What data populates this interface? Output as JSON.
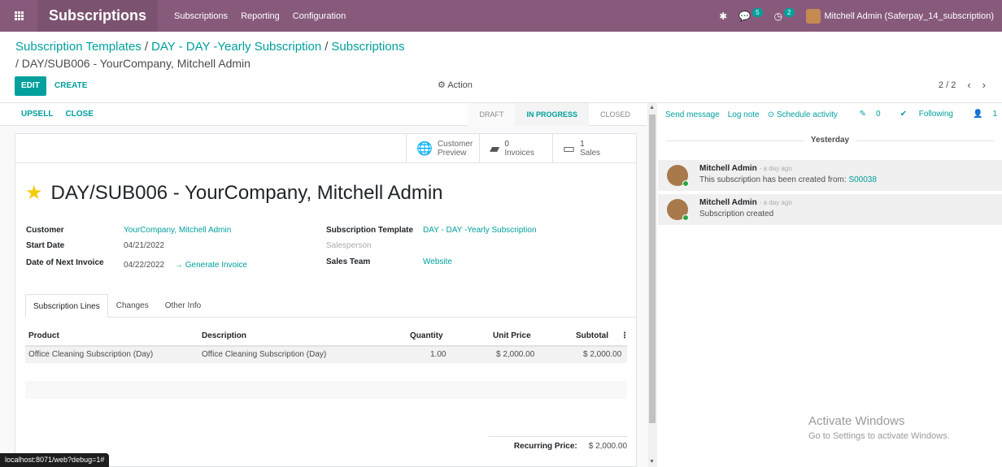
{
  "topbar": {
    "app_name": "Subscriptions",
    "menu": [
      "Subscriptions",
      "Reporting",
      "Configuration"
    ],
    "messages_count": "5",
    "activities_count": "2",
    "user_name": "Mitchell Admin (Saferpay_14_subscription)"
  },
  "breadcrumb": {
    "level1": "Subscription Templates",
    "level2": "DAY - DAY -Yearly Subscription",
    "level3": "Subscriptions",
    "current": "/ DAY/SUB006 - YourCompany, Mitchell Admin"
  },
  "control": {
    "edit_label": "EDIT",
    "create_label": "CREATE",
    "action_label": "Action",
    "pager": "2 / 2"
  },
  "statusbar": {
    "upsell_label": "UPSELL",
    "close_label": "CLOSE",
    "stages": [
      "DRAFT",
      "IN PROGRESS",
      "CLOSED"
    ],
    "active_stage": "IN PROGRESS"
  },
  "smart_buttons": {
    "customer_preview": "Customer Preview",
    "customer_preview_l1": "Customer",
    "customer_preview_l2": "Preview",
    "invoices_count": "0",
    "invoices_label": "Invoices",
    "sales_count": "1",
    "sales_label": "Sales"
  },
  "record": {
    "title": "DAY/SUB006 - YourCompany, Mitchell Admin",
    "customer_label": "Customer",
    "customer": "YourCompany, Mitchell Admin",
    "start_date_label": "Start Date",
    "start_date": "04/21/2022",
    "next_invoice_label": "Date of Next Invoice",
    "next_invoice": "04/22/2022",
    "generate_invoice": "Generate Invoice",
    "template_label": "Subscription Template",
    "template": "DAY - DAY -Yearly Subscription",
    "salesperson_label": "Salesperson",
    "sales_team_label": "Sales Team",
    "sales_team": "Website"
  },
  "tabs": [
    "Subscription Lines",
    "Changes",
    "Other Info"
  ],
  "lines": {
    "headers": {
      "product": "Product",
      "description": "Description",
      "quantity": "Quantity",
      "unit_price": "Unit Price",
      "subtotal": "Subtotal"
    },
    "rows": [
      {
        "product": "Office Cleaning Subscription (Day)",
        "description": "Office Cleaning Subscription (Day)",
        "quantity": "1.00",
        "unit_price": "$ 2,000.00",
        "subtotal": "$ 2,000.00"
      }
    ],
    "recurring_label": "Recurring Price:",
    "recurring_value": "$ 2,000.00"
  },
  "chatter": {
    "send_message": "Send message",
    "log_note": "Log note",
    "schedule_activity": "Schedule activity",
    "attachments": "0",
    "following": "Following",
    "followers": "1",
    "day_separator": "Yesterday",
    "messages": [
      {
        "author": "Mitchell Admin",
        "ago": "- a day ago",
        "body": "This subscription has been created from: ",
        "ref": "S00038"
      },
      {
        "author": "Mitchell Admin",
        "ago": "- a day ago",
        "body": "Subscription created",
        "ref": ""
      }
    ]
  },
  "watermark": {
    "line1": "Activate Windows",
    "line2": "Go to Settings to activate Windows."
  },
  "status_url": "localhost:8071/web?debug=1#",
  "colors": {
    "brand": "#875A7B",
    "accent": "#00A09D",
    "star": "#f3cc00"
  }
}
